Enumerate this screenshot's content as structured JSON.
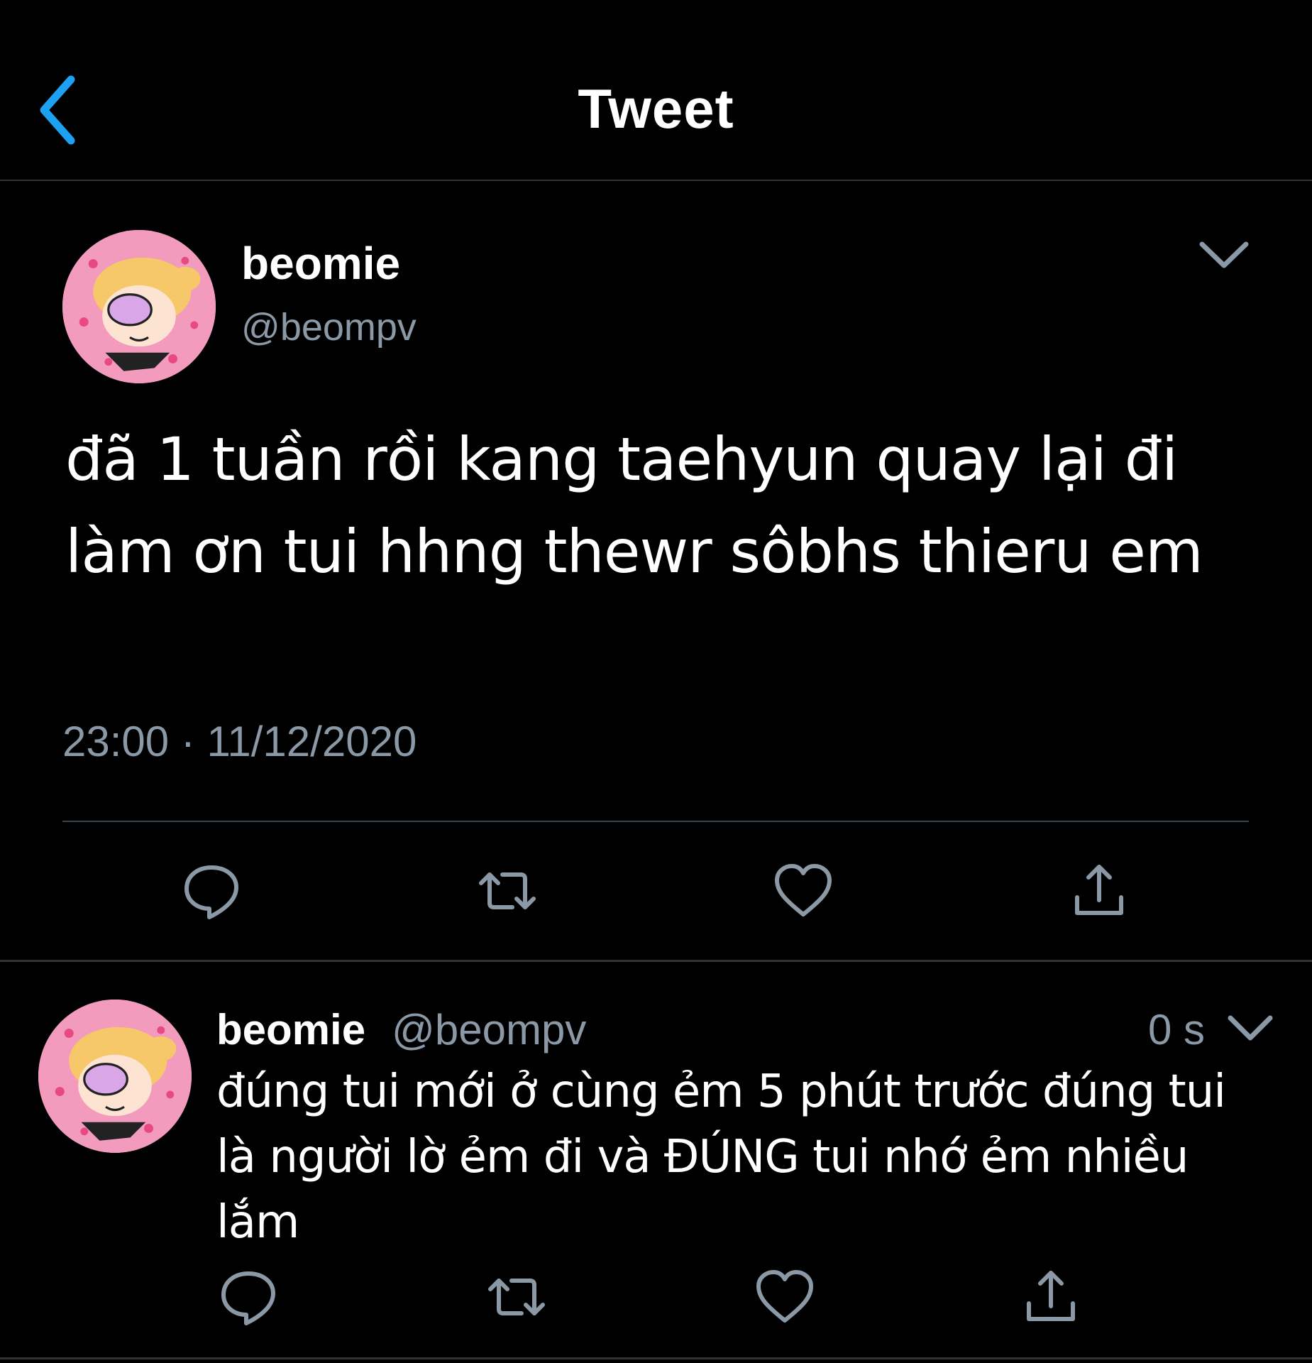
{
  "header": {
    "title": "Tweet",
    "back_icon": "chevron-left-icon",
    "accent_color": "#1da1f2"
  },
  "main_tweet": {
    "display_name": "beomie",
    "handle": "@beompv",
    "text": "đã 1 tuần rồi kang taehyun quay lại đi làm ơn tui hhng thewr sôbhs thieru em",
    "timestamp": "23:00 · 11/12/2020",
    "avatar_icon": "powerpuff-avatar",
    "actions": [
      "reply-icon",
      "retweet-icon",
      "like-icon",
      "share-icon"
    ]
  },
  "reply_tweet": {
    "display_name": "beomie",
    "handle": "@beompv",
    "age": "0 s",
    "text": "đúng tui mới ở cùng ẻm 5 phút trước đúng tui là người lờ ẻm đi và ĐÚNG tui nhớ ẻm nhiều lắm",
    "avatar_icon": "powerpuff-avatar",
    "actions": [
      "reply-icon",
      "retweet-icon",
      "like-icon",
      "share-icon"
    ]
  }
}
